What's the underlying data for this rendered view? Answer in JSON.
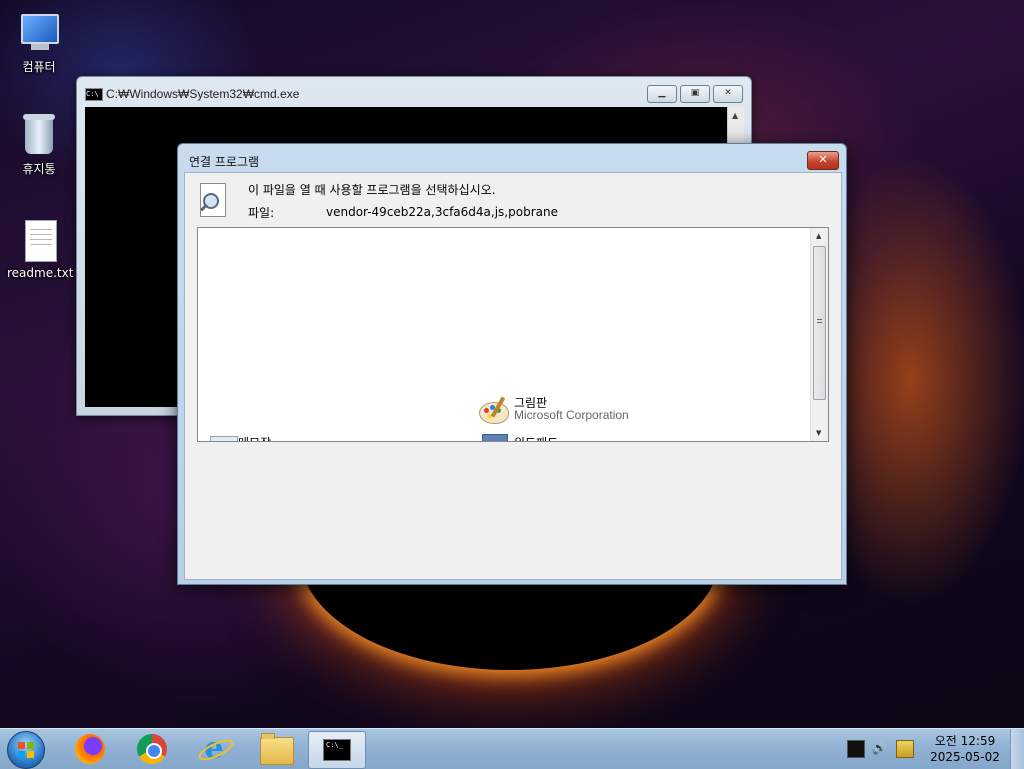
{
  "desktop": {
    "icons": [
      {
        "label": "컴퓨터"
      },
      {
        "label": "휴지통"
      },
      {
        "label": "readme.txt"
      }
    ]
  },
  "cmd_window": {
    "title": "C:₩Windows₩System32₩cmd.exe",
    "icon_text": "C:\\"
  },
  "dialog": {
    "title": "연결 프로그램",
    "instruction": "이 파일을 열 때 사용할 프로그램을 선택하십시오.",
    "file_label": "파일:",
    "file_name": "vendor-49ceb22a,3cfa6d4a,js,pobrane",
    "programs": [
      {
        "name": "그림판",
        "publisher": "Microsoft Corporation",
        "icon": "paint-palette-icon"
      },
      {
        "name": "메모장",
        "publisher": "",
        "icon": "notepad-icon"
      },
      {
        "name": "워드패드",
        "publisher": "",
        "icon": "wordpad-icon"
      }
    ]
  },
  "taskbar": {
    "apps": [
      {
        "name": "firefox",
        "icon": "firefox-icon"
      },
      {
        "name": "chrome",
        "icon": "chrome-icon"
      },
      {
        "name": "internet-explorer",
        "icon": "internet-explorer-icon"
      },
      {
        "name": "file-explorer",
        "icon": "folder-icon"
      },
      {
        "name": "cmd",
        "icon": "cmd-icon",
        "active": true
      }
    ],
    "cmd_glyph_text": "C:\\_",
    "clock": {
      "time": "오전 12:59",
      "date": "2025-05-02"
    }
  }
}
